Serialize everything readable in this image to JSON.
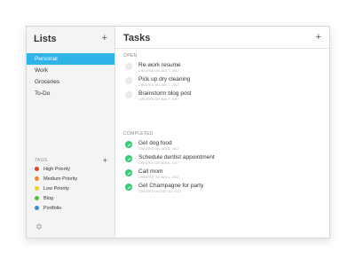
{
  "sidebar": {
    "title": "Lists",
    "add_icon": "plus-icon",
    "lists": [
      {
        "label": "Personal",
        "active": true
      },
      {
        "label": "Work",
        "active": false
      },
      {
        "label": "Groceries",
        "active": false
      },
      {
        "label": "To-Do",
        "active": false
      }
    ],
    "tags_label": "TAGS",
    "tags": [
      {
        "label": "High Priority",
        "color": "#e8412b"
      },
      {
        "label": "Medium Priority",
        "color": "#f28c1e"
      },
      {
        "label": "Low Priority",
        "color": "#f5d214"
      },
      {
        "label": "Blog",
        "color": "#57c12f"
      },
      {
        "label": "Portfolio",
        "color": "#3b8fe0"
      }
    ],
    "settings_icon": "gear-icon"
  },
  "main": {
    "title": "Tasks",
    "add_icon": "plus-icon",
    "open_label": "OPEN",
    "open_tasks": [
      {
        "title": "Re-work resume",
        "created": "CREATED ON JAN 7, 2017"
      },
      {
        "title": "Pick up dry cleaning",
        "created": "CREATED ON JAN 7, 2017"
      },
      {
        "title": "Brainstorm blog post",
        "created": "CREATED ON JAN 7, 2017"
      }
    ],
    "completed_label": "COMPLETED",
    "completed_tasks": [
      {
        "title": "Get dog food",
        "created": "CREATED ON JAN 8, 2017"
      },
      {
        "title": "Schedule dentist appointment",
        "created": "CREATED ON JAN 6, 2017"
      },
      {
        "title": "Call mom",
        "created": "CREATED ON JAN 4, 2017"
      },
      {
        "title": "Get Champagne for party",
        "created": "CREATED ON DEC 31, 2017"
      }
    ]
  },
  "colors": {
    "accent": "#2fb3e9",
    "complete": "#2ecc71"
  }
}
